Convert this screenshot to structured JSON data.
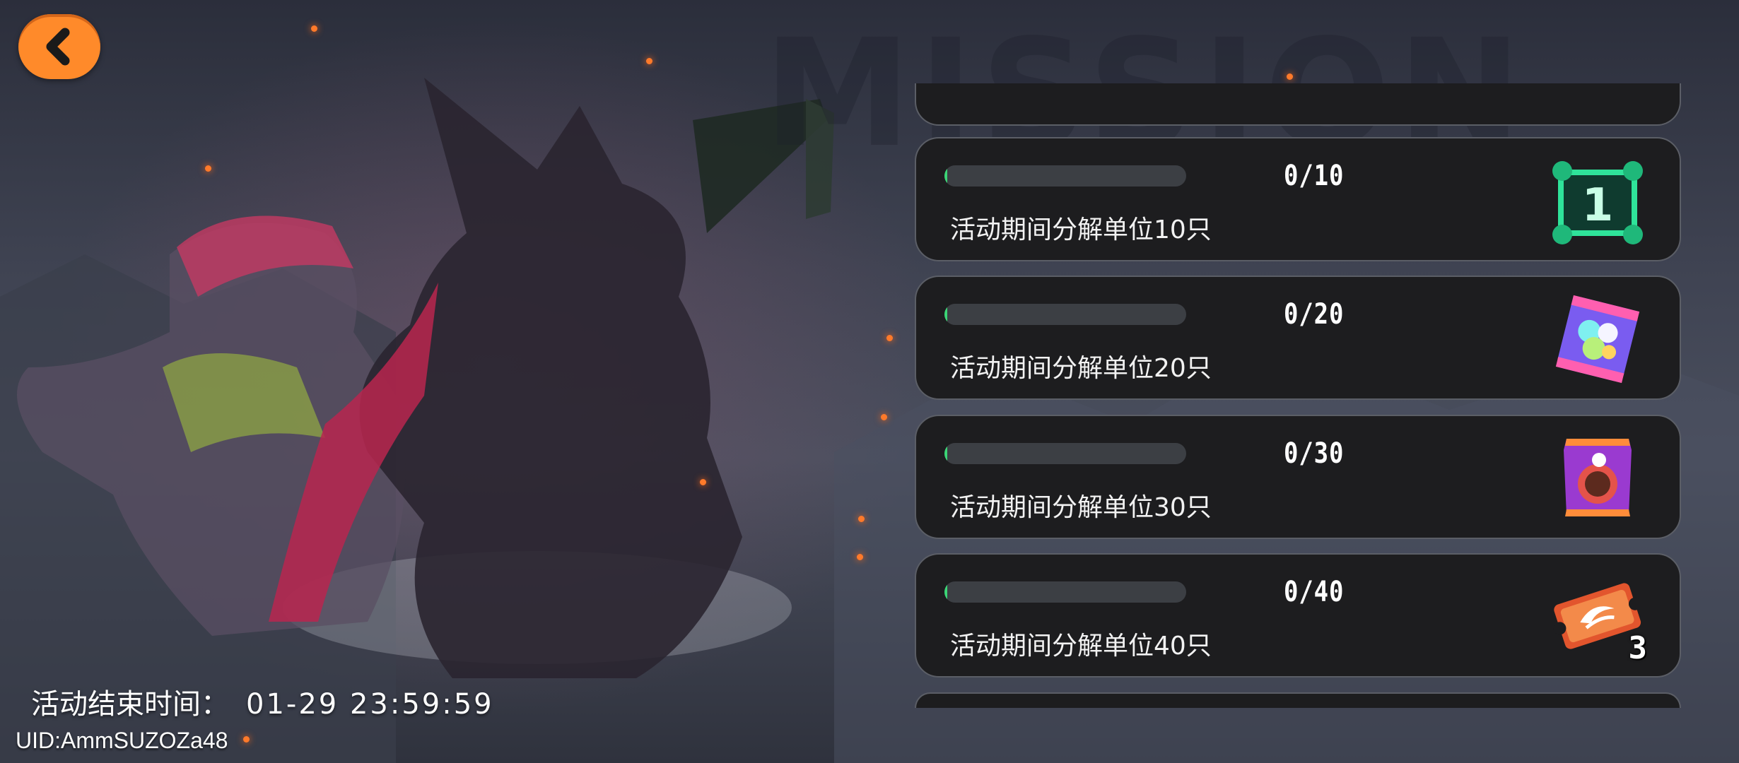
{
  "header": {
    "back_icon": "chevron-left-icon",
    "back_button_color": "#ff8a2a"
  },
  "background": {
    "watermark_text": "MISSION"
  },
  "missions": [
    {
      "count": "0/10",
      "progress": 0,
      "description": "活动期间分解单位10只",
      "reward_icon": "number-one-token-icon",
      "reward_qty": ""
    },
    {
      "count": "0/20",
      "progress": 0,
      "description": "活动期间分解单位20只",
      "reward_icon": "candy-pack-icon",
      "reward_qty": ""
    },
    {
      "count": "0/30",
      "progress": 0,
      "description": "活动期间分解单位30只",
      "reward_icon": "snack-bag-icon",
      "reward_qty": ""
    },
    {
      "count": "0/40",
      "progress": 0,
      "description": "活动期间分解单位40只",
      "reward_icon": "ticket-icon",
      "reward_qty": "3"
    }
  ],
  "footer": {
    "end_time_label": "活动结束时间：",
    "end_time_value": "01-29 23:59:59",
    "uid": "UID:AmmSUZOZa48"
  },
  "colors": {
    "progress_fill": "#3bd676",
    "card_bg": "#1d1d1f",
    "card_border": "#5b5e66"
  }
}
